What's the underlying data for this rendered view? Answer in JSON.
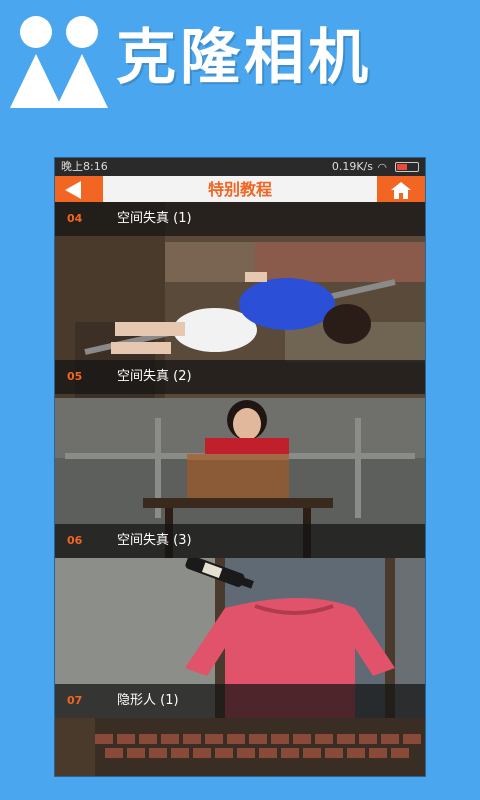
{
  "app": {
    "title": "克隆相机"
  },
  "statusbar": {
    "time": "晚上8:16",
    "speed": "0.19K/s"
  },
  "appbar": {
    "title": "特别教程"
  },
  "tutorials": [
    {
      "num": "04",
      "title": "空间失真 (1)"
    },
    {
      "num": "05",
      "title": "空间失真 (2)"
    },
    {
      "num": "06",
      "title": "空间失真 (3)"
    },
    {
      "num": "07",
      "title": "隐形人 (1)"
    }
  ],
  "colors": {
    "background": "#4aa6ee",
    "accent": "#f26522"
  },
  "icons": {
    "logo": "two-person-logo-icon",
    "back": "back-arrow-icon",
    "home": "home-icon",
    "wifi": "wifi-icon",
    "battery": "battery-icon"
  }
}
